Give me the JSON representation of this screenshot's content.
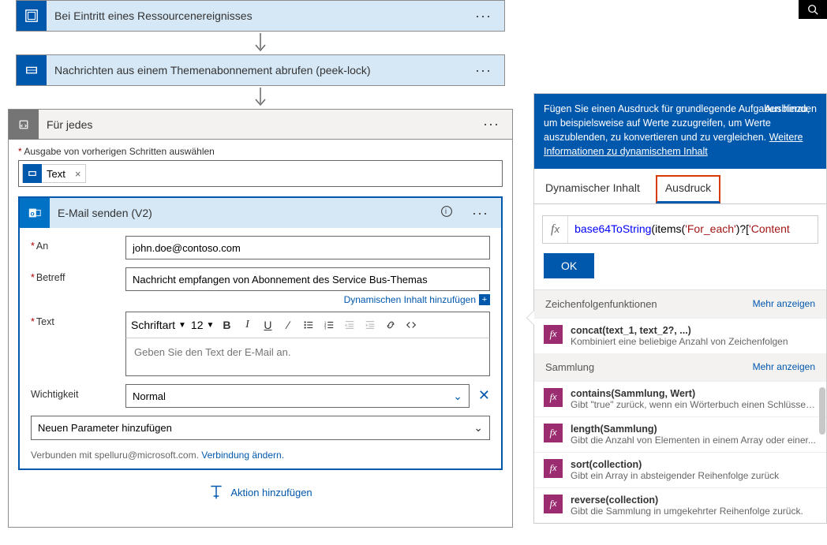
{
  "steps": {
    "trigger_title": "Bei Eintritt eines Ressourcenereignisses",
    "get_msgs_title": "Nachrichten aus einem Themenabonnement abrufen (peek-lock)",
    "foreach_title": "Für jedes",
    "foreach_input_label": "Ausgabe von vorherigen Schritten auswählen",
    "foreach_token": "Text"
  },
  "email": {
    "card_title": "E-Mail senden (V2)",
    "to_label": "An",
    "to_value": "john.doe@contoso.com",
    "subject_label": "Betreff",
    "subject_value": "Nachricht empfangen von Abonnement des Service Bus-Themas",
    "add_dynamic": "Dynamischen Inhalt hinzufügen",
    "body_label": "Text",
    "body_placeholder": "Geben Sie den Text der E-Mail an.",
    "font_label": "Schriftart",
    "font_size": "12",
    "importance_label": "Wichtigkeit",
    "importance_value": "Normal",
    "new_param": "Neuen Parameter hinzufügen",
    "connected_prefix": "Verbunden mit spelluru@microsoft.com. ",
    "change_connection": "Verbindung ändern.",
    "add_action": "Aktion hinzufügen"
  },
  "panel": {
    "header_text": "Fügen Sie einen Ausdruck für grundlegende Aufgaben hinzu, um beispielsweise auf Werte zuzugreifen, um Werte auszublenden, zu konvertieren und zu vergleichen. ",
    "header_more": "Weitere Informationen zu dynamischem Inhalt",
    "hide": "Ausblenden",
    "tab_dynamic": "Dynamischer Inhalt",
    "tab_expression": "Ausdruck",
    "expr_fn": "base64ToString",
    "expr_rest_open": "(items(",
    "expr_str": "'For_each'",
    "expr_rest_close": ")?[",
    "expr_str2": "'Content",
    "ok": "OK",
    "section_string": "Zeichenfolgenfunktionen",
    "section_collection": "Sammlung",
    "show_more": "Mehr anzeigen",
    "functions": [
      {
        "name": "concat(text_1, text_2?, ...)",
        "desc": "Kombiniert eine beliebige Anzahl von Zeichenfolgen"
      },
      {
        "name": "contains(Sammlung, Wert)",
        "desc": "Gibt \"true\" zurück, wenn ein Wörterbuch einen Schlüssel ..."
      },
      {
        "name": "length(Sammlung)",
        "desc": "Gibt die Anzahl von Elementen in einem Array oder einer..."
      },
      {
        "name": "sort(collection)",
        "desc": "Gibt ein Array in absteigender Reihenfolge zurück"
      },
      {
        "name": "reverse(collection)",
        "desc": "Gibt die Sammlung in umgekehrter Reihenfolge zurück."
      }
    ]
  }
}
